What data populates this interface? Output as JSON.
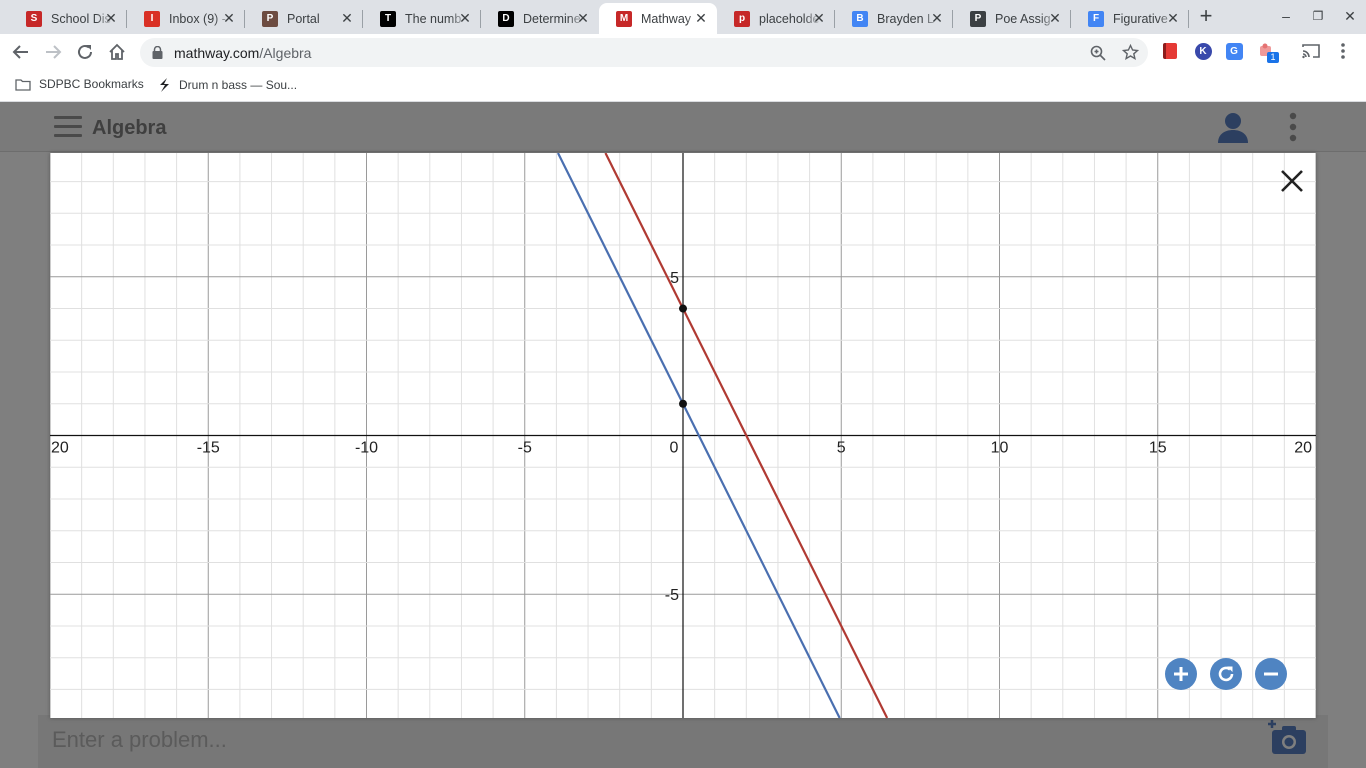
{
  "browser": {
    "tabs": [
      {
        "title": "School Dis",
        "icon": "school-district-icon",
        "color": "#c62828"
      },
      {
        "title": "Inbox (9) -",
        "icon": "gmail-icon",
        "color": "#d93025"
      },
      {
        "title": "Portal",
        "icon": "portal-icon",
        "color": "#6d4c41"
      },
      {
        "title": "The numb",
        "icon": "brainly-icon",
        "color": "#000000"
      },
      {
        "title": "Determine",
        "icon": "brainly-icon",
        "color": "#000000"
      },
      {
        "title": "Mathway",
        "icon": "mathway-icon",
        "color": "#c62828",
        "active": true
      },
      {
        "title": "placeholde",
        "icon": "mathway-icon",
        "color": "#c62828"
      },
      {
        "title": "Brayden L",
        "icon": "docs-icon",
        "color": "#4285f4"
      },
      {
        "title": "Poe Assig",
        "icon": "classroom-icon",
        "color": "#3c4043"
      },
      {
        "title": "Figurative",
        "icon": "play-icon",
        "color": "#4285f4"
      }
    ],
    "url_host": "mathway.com",
    "url_path": "/Algebra",
    "bookmarks": [
      {
        "label": "SDPBC Bookmarks",
        "icon": "folder-icon"
      },
      {
        "label": "Drum n bass — Sou...",
        "icon": "soundcloud-icon"
      }
    ],
    "extension_badge": "1"
  },
  "app": {
    "title": "Algebra",
    "problem_placeholder": "Enter a problem..."
  },
  "chart_data": {
    "type": "line",
    "title": "",
    "xlabel": "",
    "ylabel": "",
    "xlim": [
      -20,
      20
    ],
    "ylim": [
      -8.9,
      8.9
    ],
    "x_ticks": [
      -20,
      -15,
      -10,
      -5,
      0,
      5,
      10,
      15,
      20
    ],
    "y_ticks": [
      5,
      -5
    ],
    "x_tick_labels": [
      "20",
      "-15",
      "-10",
      "-5",
      "0",
      "5",
      "10",
      "15",
      "20"
    ],
    "y_tick_labels": [
      "5",
      "-5"
    ],
    "grid": true,
    "series": [
      {
        "color": "#4a6fb0",
        "slope": -2,
        "intercept": 1
      },
      {
        "color": "#b03a33",
        "slope": -2,
        "intercept": 4
      }
    ],
    "points": [
      {
        "x": 0,
        "y": 4
      },
      {
        "x": 0,
        "y": 1
      }
    ]
  }
}
